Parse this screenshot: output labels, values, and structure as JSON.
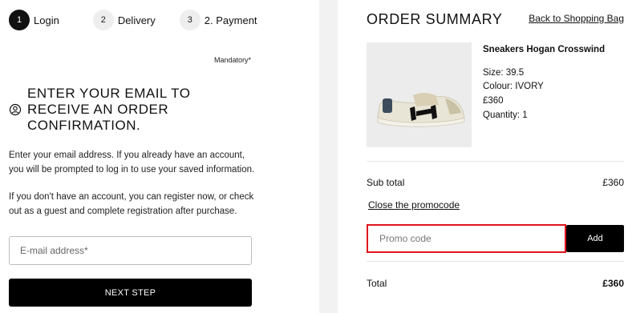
{
  "checkout_steps": [
    {
      "number": "1",
      "label": "Login",
      "active": true
    },
    {
      "number": "2",
      "label": "Delivery",
      "active": false
    },
    {
      "number": "3",
      "label": "2. Payment",
      "active": false
    }
  ],
  "login": {
    "mandatory_note": "Mandatory*",
    "heading": "ENTER YOUR EMAIL TO RECEIVE AN ORDER CONFIRMATION.",
    "description_1": "Enter your email address. If you already have an account, you will be prompted to log in to use your saved information.",
    "description_2": "If you don't have an account, you can register now, or check out as a guest and complete registration after purchase.",
    "email_placeholder": "E-mail address*",
    "email_value": "",
    "next_button": "NEXT STEP",
    "icon": "user-icon"
  },
  "summary": {
    "title": "ORDER SUMMARY",
    "back_link": "Back to Shopping Bag",
    "product": {
      "name": "Sneakers Hogan Crosswind",
      "size": "Size: 39.5",
      "colour": "Colour: IVORY",
      "price": "£360",
      "quantity": "Quantity: 1"
    },
    "subtotal_label": "Sub total",
    "subtotal_value": "£360",
    "close_promo": "Close the promocode",
    "promo_placeholder": "Promo code",
    "promo_value": "",
    "add_button": "Add",
    "total_label": "Total",
    "total_value": "£360"
  },
  "colors": {
    "accent": "#000000",
    "promo_border": "#e0141e",
    "divider": "#f2f2f2"
  }
}
